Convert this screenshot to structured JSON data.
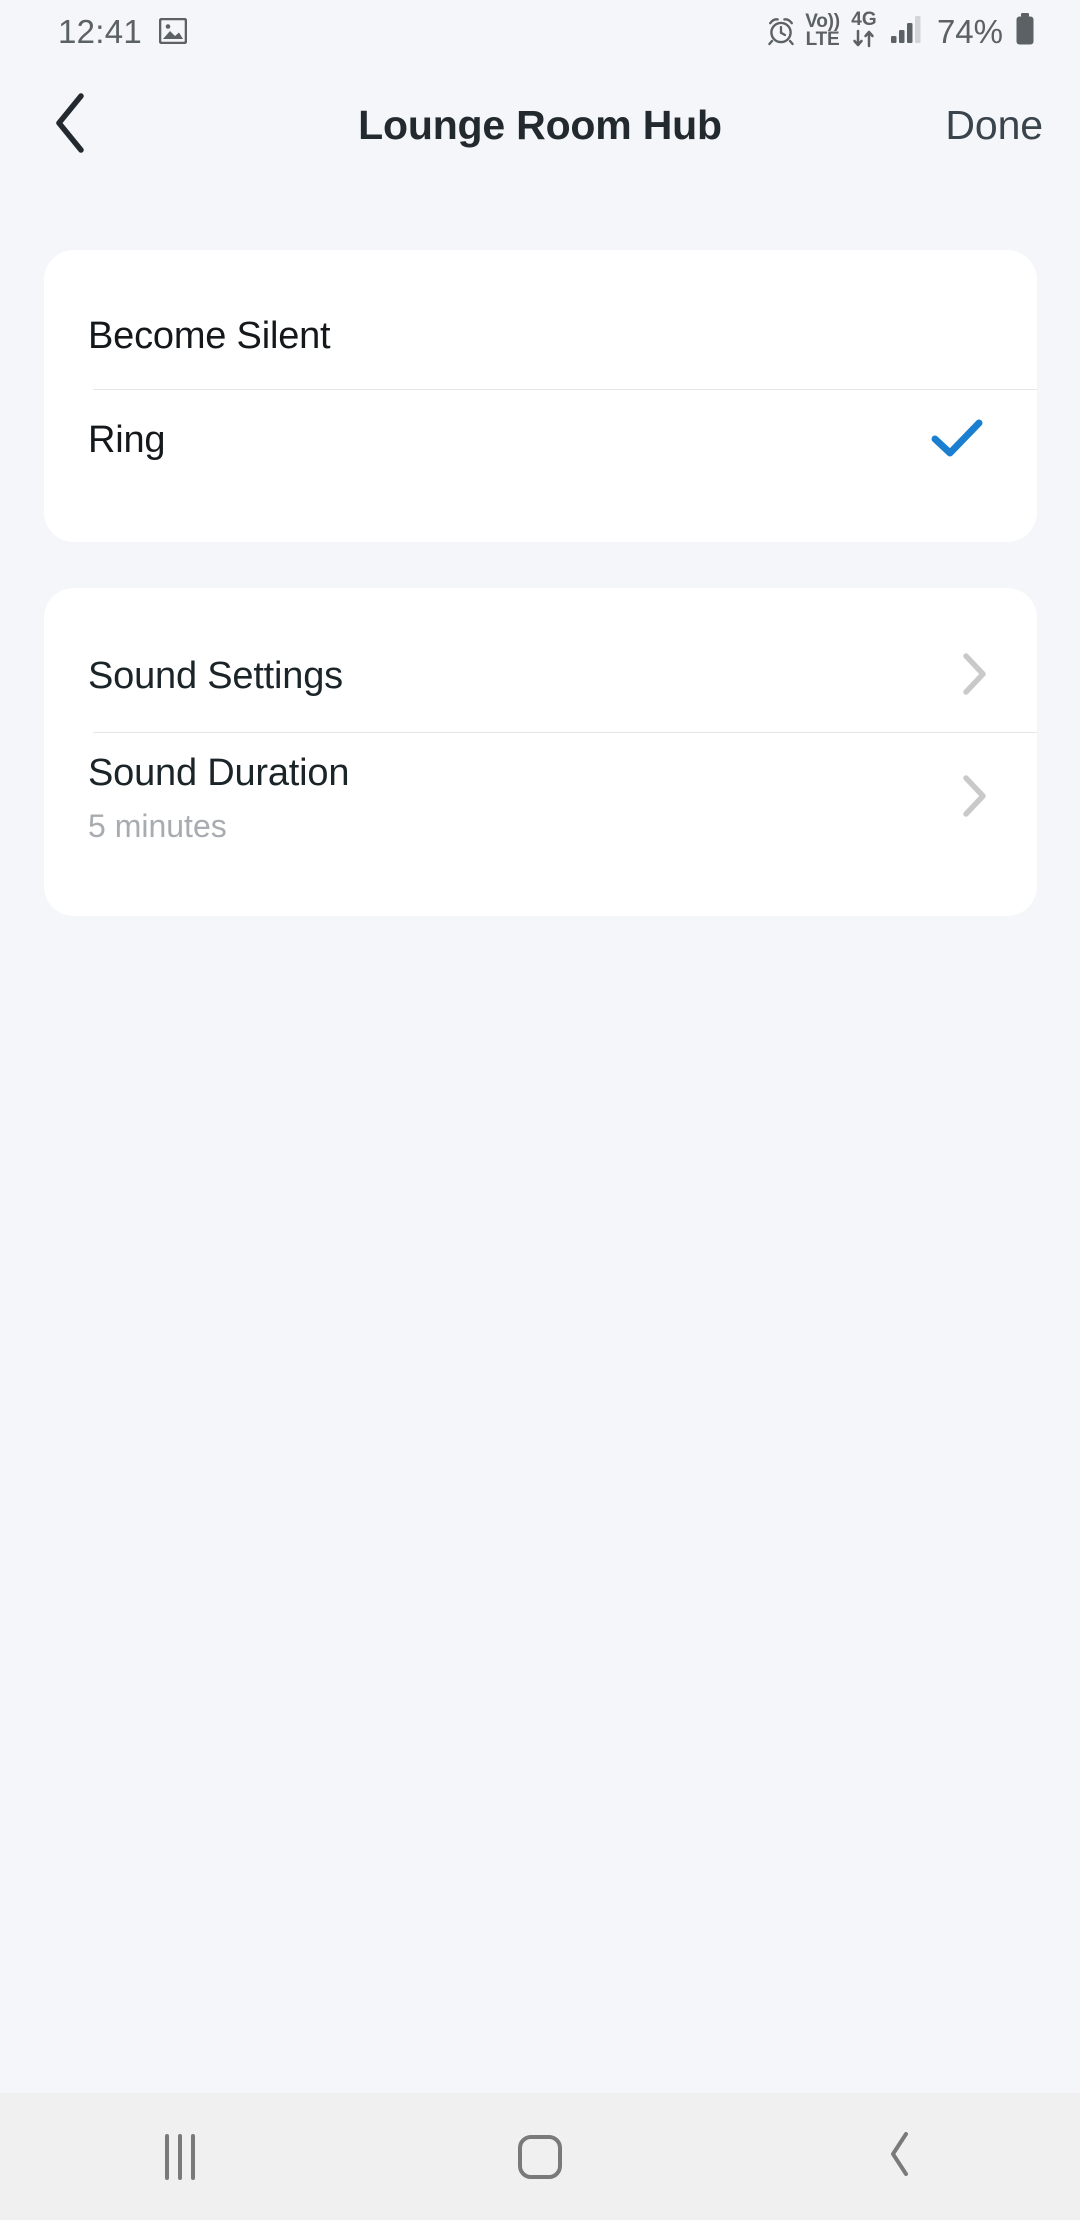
{
  "status_bar": {
    "time": "12:41",
    "photo_icon": "photo-icon",
    "alarm_icon": "alarm-icon",
    "volte_line1": "Vo))",
    "volte_line2": "LTE",
    "network_type": "4G",
    "data_arrows_icon": "data-transfer-arrows-icon",
    "signal_icon": "signal-bars-icon",
    "battery_percent": "74%",
    "battery_icon": "battery-icon"
  },
  "header": {
    "back_icon": "chevron-left-icon",
    "title": "Lounge Room Hub",
    "done_label": "Done"
  },
  "mode_card": {
    "rows": [
      {
        "title": "Become Silent",
        "selected": false
      },
      {
        "title": "Ring",
        "selected": true,
        "check_icon": "check-icon"
      }
    ]
  },
  "sound_card": {
    "rows": [
      {
        "title": "Sound Settings",
        "subtitle": "",
        "chevron_icon": "chevron-right-icon"
      },
      {
        "title": "Sound Duration",
        "subtitle": "5 minutes",
        "chevron_icon": "chevron-right-icon"
      }
    ]
  },
  "nav_bar": {
    "recents_icon": "recents-icon",
    "home_icon": "home-icon",
    "back_icon": "nav-back-chevron-icon"
  },
  "colors": {
    "page_background": "#f5f6fa",
    "card_background": "#ffffff",
    "accent_check": "#1a7fd0",
    "chevron_gray": "#c9c9c9",
    "title_text": "#222a2f",
    "subtitle_text": "#a8acb0",
    "nav_background": "#f0f0f0"
  }
}
